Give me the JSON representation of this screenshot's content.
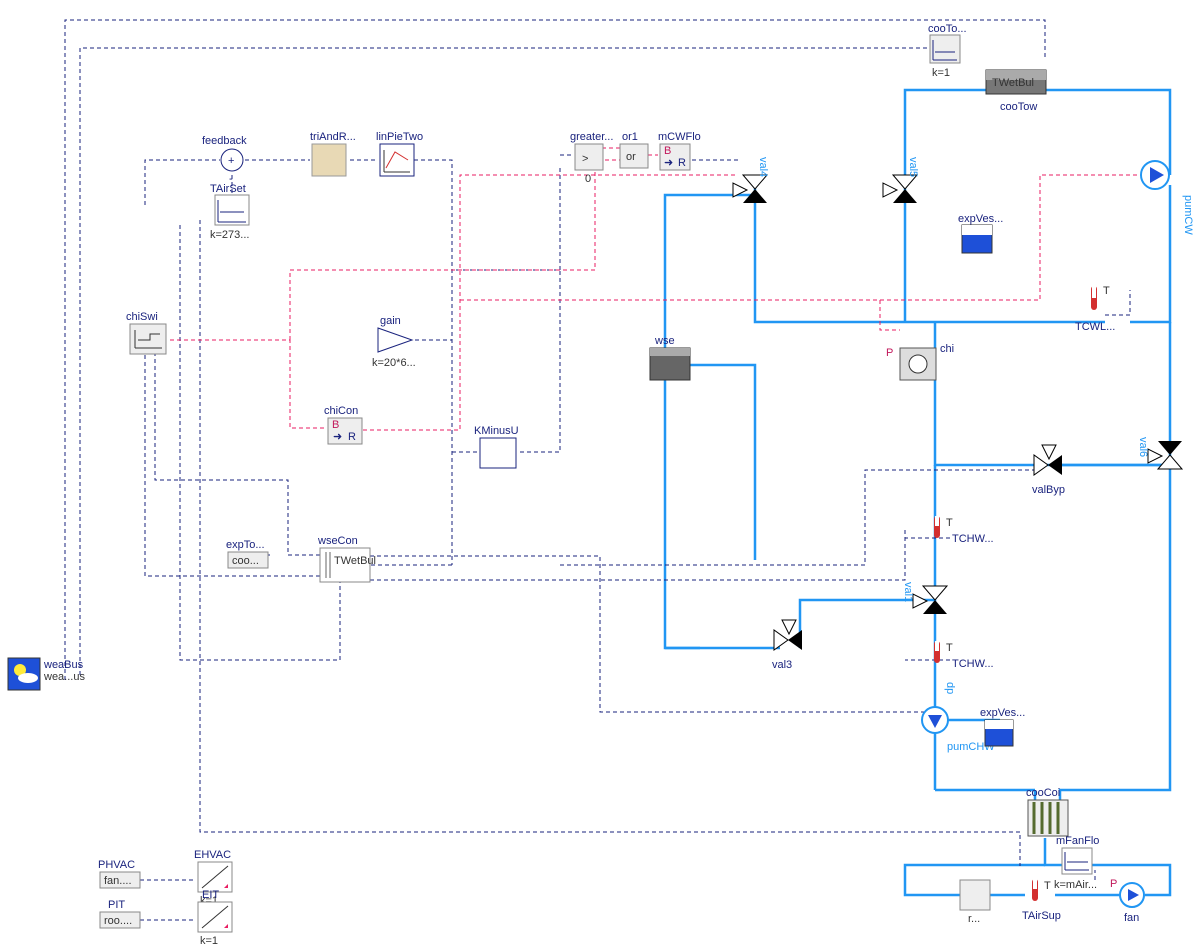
{
  "labels": {
    "cooTo": "cooTo...",
    "cooTo_k": "k=1",
    "TWetBul_top": "TWetBul",
    "cooTow": "cooTow",
    "pumCW": "pumCW",
    "feedback": "feedback",
    "triAndR": "triAndR...",
    "linPieTwo": "linPieTwo",
    "greater": "greater...",
    "gt": ">",
    "gt_sub": "0",
    "or1": "or1",
    "or_txt": "or",
    "mCWFlo": "mCWFlo",
    "BR_B": "B",
    "BR_R": "R",
    "arrow": "➜",
    "TAirSet": "TAirSet",
    "TAirSet_k": "k=273...",
    "val4": "val4",
    "val5": "val5",
    "expVes": "expVes...",
    "T_only": "T",
    "TCWL": "TCWL...",
    "chiSwi": "chiSwi",
    "gain": "gain",
    "gain_k": "k=20*6...",
    "wse": "wse",
    "P": "P",
    "chi": "chi",
    "chiCon": "chiCon",
    "KMinusU": "KMinusU",
    "val6": "val6",
    "valByp": "valByp",
    "TCHW_1": "TCHW...",
    "expTo": "expTo...",
    "coo": "coo...",
    "wseCon": "wseCon",
    "TWetBul_mid": "TWetBul",
    "val1": "val1",
    "val3": "val3",
    "TCHW_2": "TCHW...",
    "dp": "dp",
    "pumCHW": "pumCHW",
    "expVes2": "expVes...",
    "cooCoi": "cooCoi",
    "mFanFlo": "mFanFlo",
    "mFanFlo_k": "k=mAir...",
    "TAirSup": "TAirSup",
    "fan": "fan",
    "r": "r...",
    "weaBus": "weaBus",
    "weaBus2": "wea...us",
    "PHVAC": "PHVAC",
    "fan_box": "fan....",
    "EHVAC": "EHVAC",
    "EHVAC_k": "k=1",
    "PIT": "PIT",
    "roo": "roo....",
    "EIT": "EIT",
    "EIT_k": "k=1"
  },
  "colors": {
    "navy": "#1a237e",
    "sky": "#2196f3",
    "pink": "#e91e63",
    "tan": "#e8d9b5",
    "blue_fill": "#1e50d8"
  }
}
